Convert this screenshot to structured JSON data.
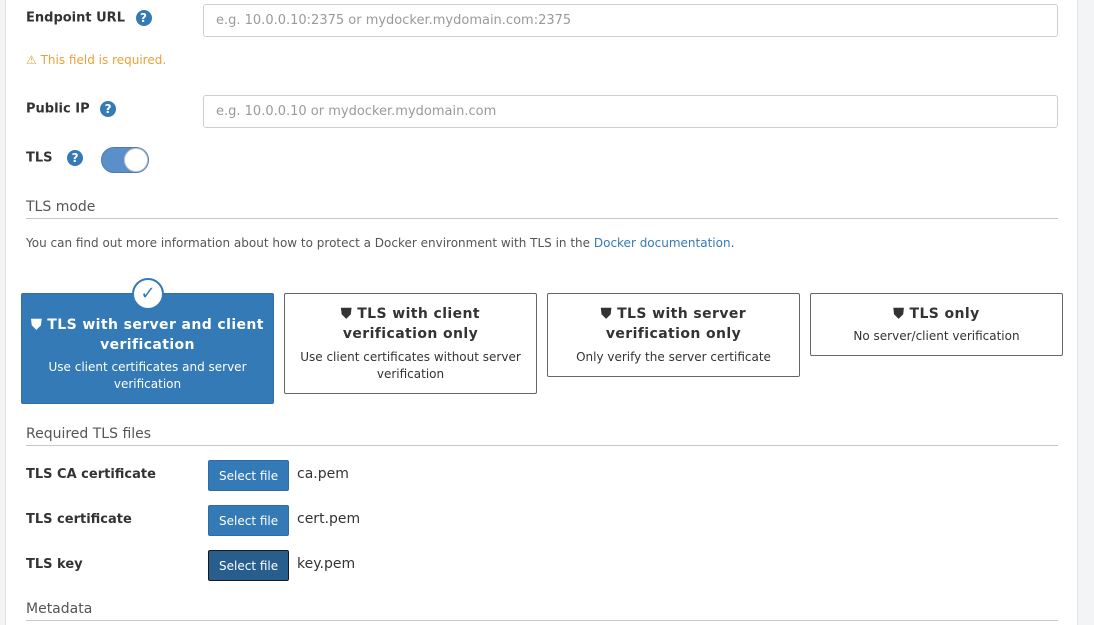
{
  "endpoint": {
    "label": "Endpoint URL",
    "help": "?",
    "placeholder": "e.g. 10.0.0.10:2375 or mydocker.mydomain.com:2375",
    "value": "",
    "warning": "This field is required.",
    "warning_icon": "warning-triangle-icon"
  },
  "public_ip": {
    "label": "Public IP",
    "help": "?",
    "placeholder": "e.g. 10.0.0.10 or mydocker.mydomain.com",
    "value": ""
  },
  "tls": {
    "label": "TLS",
    "help": "?",
    "enabled": true,
    "toggle_color": "#5b8fc9"
  },
  "tls_mode": {
    "title": "TLS mode",
    "info_prefix": "You can find out more information about how to protect a Docker environment with TLS in the",
    "info_link": "Docker documentation",
    "info_suffix": ".",
    "options": [
      {
        "title": "TLS with server and client verification",
        "subtitle": "Use client certificates and server verification",
        "selected": true,
        "icon": "shield-icon"
      },
      {
        "title": "TLS with client verification only",
        "subtitle": "Use client certificates without server verification",
        "selected": false,
        "icon": "shield-icon"
      },
      {
        "title": "TLS with server verification only",
        "subtitle": "Only verify the server certificate",
        "selected": false,
        "icon": "shield-icon"
      },
      {
        "title": "TLS only",
        "subtitle": "No server/client verification",
        "selected": false,
        "icon": "shield-icon"
      }
    ],
    "accent_color": "#337ab7"
  },
  "required_files": {
    "title": "Required TLS files",
    "rows": [
      {
        "label": "TLS CA certificate",
        "button": "Select file",
        "filename": "ca.pem"
      },
      {
        "label": "TLS certificate",
        "button": "Select file",
        "filename": "cert.pem"
      },
      {
        "label": "TLS key",
        "button": "Select file",
        "filename": "key.pem"
      }
    ]
  },
  "metadata": {
    "title": "Metadata"
  }
}
